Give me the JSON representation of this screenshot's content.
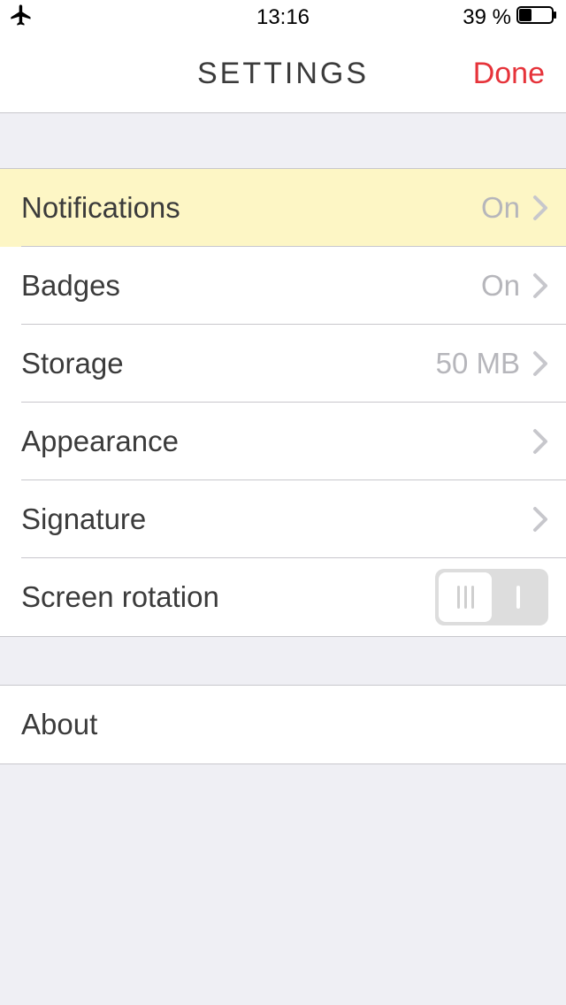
{
  "status": {
    "time": "13:16",
    "battery_pct": "39 %"
  },
  "nav": {
    "title": "SETTINGS",
    "done": "Done"
  },
  "rows": {
    "notifications": {
      "label": "Notifications",
      "value": "On"
    },
    "badges": {
      "label": "Badges",
      "value": "On"
    },
    "storage": {
      "label": "Storage",
      "value": "50 MB"
    },
    "appearance": {
      "label": "Appearance"
    },
    "signature": {
      "label": "Signature"
    },
    "screen_rotation": {
      "label": "Screen rotation"
    },
    "about": {
      "label": "About"
    }
  }
}
